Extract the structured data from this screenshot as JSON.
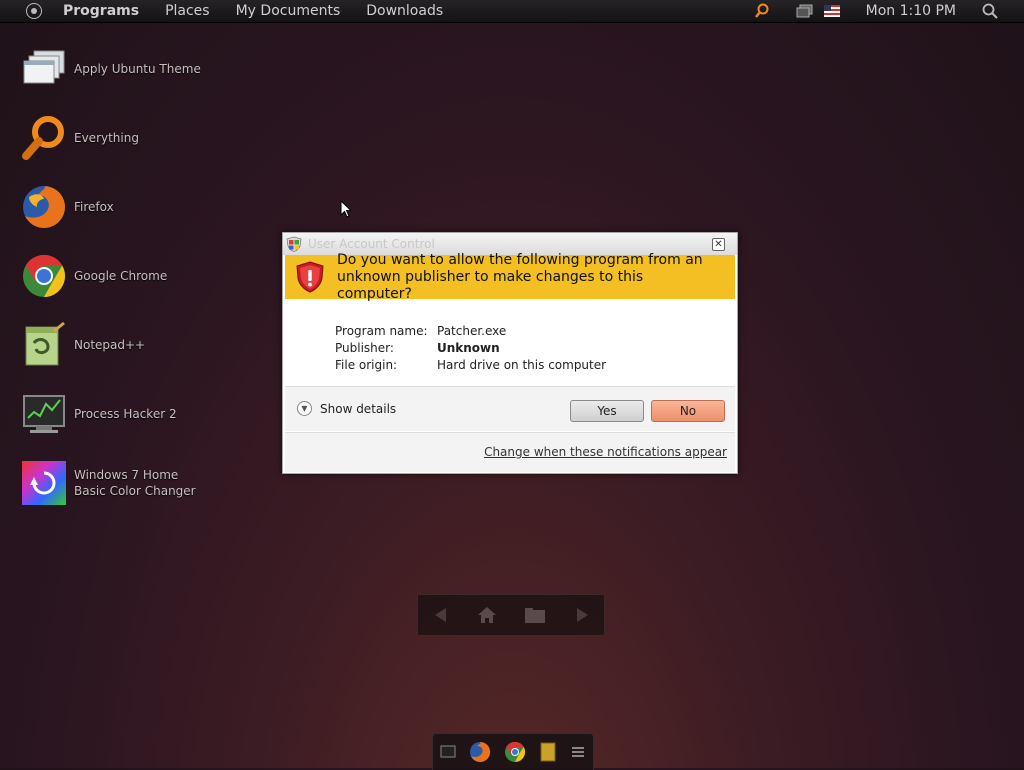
{
  "top_panel": {
    "menus": [
      "Programs",
      "Places",
      "My Documents",
      "Downloads"
    ],
    "clock": "Mon 1:10 PM",
    "tray_icons": [
      "search-tray-icon",
      "network-icon",
      "language-flag-icon",
      "search-icon"
    ]
  },
  "desktop_icons": [
    {
      "label": "Apply Ubuntu Theme"
    },
    {
      "label": "Everything"
    },
    {
      "label": "Firefox"
    },
    {
      "label": "Google Chrome"
    },
    {
      "label": "Notepad++"
    },
    {
      "label": "Process Hacker 2"
    },
    {
      "label": "Windows 7 Home Basic Color Changer"
    }
  ],
  "uac": {
    "title": "User Account Control",
    "question": "Do you want to allow the following program from an unknown publisher to make changes to this computer?",
    "program_name_label": "Program name:",
    "program_name": "Patcher.exe",
    "publisher_label": "Publisher:",
    "publisher": "Unknown",
    "file_origin_label": "File origin:",
    "file_origin": "Hard drive on this computer",
    "show_details": "Show details",
    "yes": "Yes",
    "no": "No",
    "change_link": "Change when these notifications appear"
  },
  "colors": {
    "banner": "#f3bf23",
    "no_button": "#ee8f6a"
  }
}
